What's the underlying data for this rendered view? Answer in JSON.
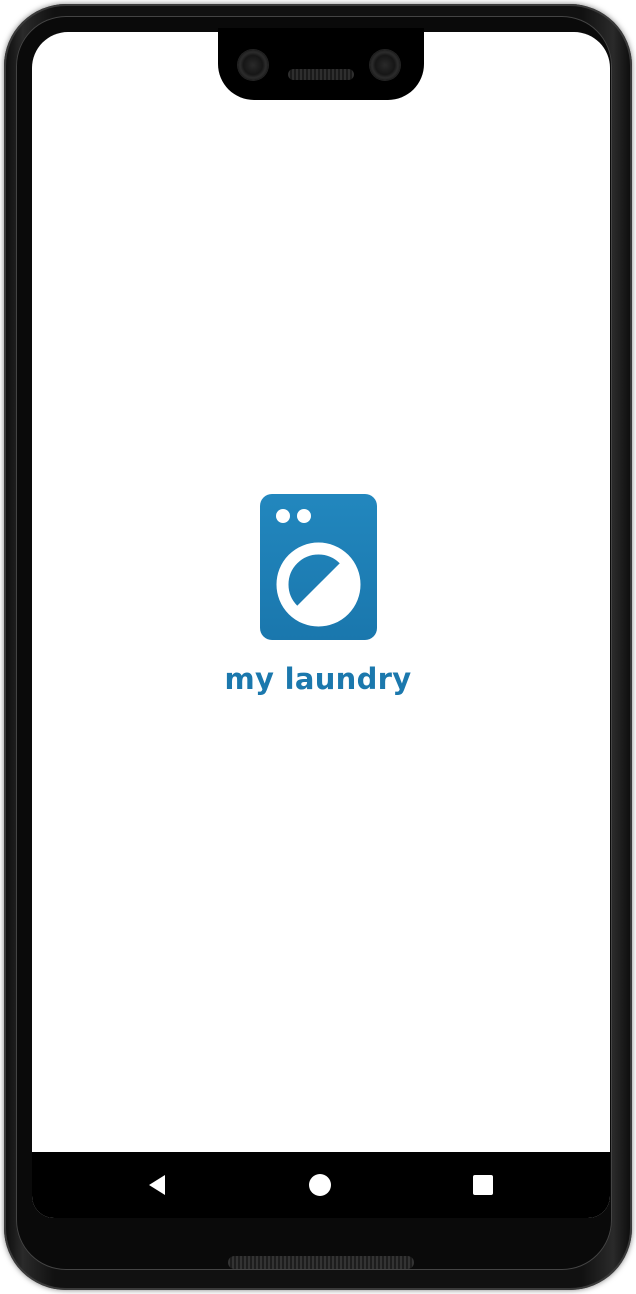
{
  "app": {
    "brand_name": "my laundry",
    "logo_icon": "washing-machine-icon",
    "brand_color": "#1b78ad"
  },
  "nav_bar": {
    "back_icon": "back-triangle-icon",
    "home_icon": "home-circle-icon",
    "recents_icon": "recents-square-icon",
    "color": "#ffffff"
  }
}
